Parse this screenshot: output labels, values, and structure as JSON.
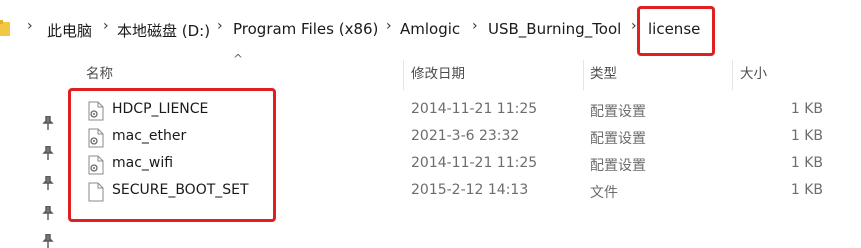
{
  "breadcrumb": {
    "items": [
      "此电脑",
      "本地磁盘 (D:)",
      "Program Files (x86)",
      "Amlogic",
      "USB_Burning_Tool",
      "license"
    ]
  },
  "columns": {
    "name": "名称",
    "date": "修改日期",
    "type": "类型",
    "size": "大小"
  },
  "files": [
    {
      "name": "HDCP_LIENCE",
      "date": "2014-11-21 11:25",
      "type": "配置设置",
      "size": "1 KB",
      "icon": "config-file-icon"
    },
    {
      "name": "mac_ether",
      "date": "2021-3-6 23:32",
      "type": "配置设置",
      "size": "1 KB",
      "icon": "config-file-icon"
    },
    {
      "name": "mac_wifi",
      "date": "2014-11-21 11:25",
      "type": "配置设置",
      "size": "1 KB",
      "icon": "config-file-icon"
    },
    {
      "name": "SECURE_BOOT_SET",
      "date": "2015-2-12 14:13",
      "type": "文件",
      "size": "1 KB",
      "icon": "blank-file-icon"
    }
  ],
  "highlight_color": "#e02020"
}
